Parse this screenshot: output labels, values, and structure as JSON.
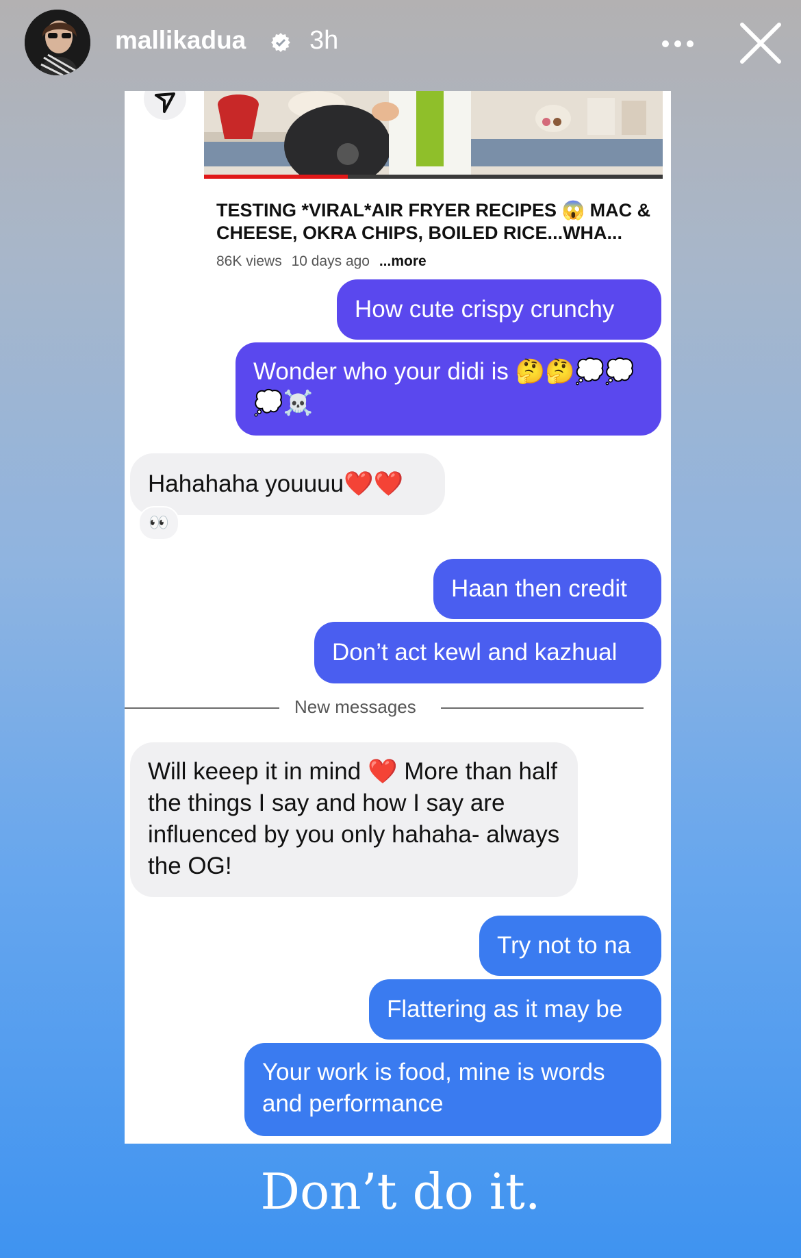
{
  "header": {
    "username": "mallikadua",
    "timestamp": "3h",
    "verified_icon": "verified-badge-icon",
    "more_icon": "more-horizontal-icon",
    "close_icon": "close-icon"
  },
  "video": {
    "title": "TESTING *VIRAL*AIR FRYER RECIPES 😱 MAC & CHEESE, OKRA CHIPS, BOILED RICE...WHA...",
    "views": "86K views",
    "age": "10 days ago",
    "more": "...more"
  },
  "messages": [
    {
      "from": "me",
      "text": "How cute crispy crunchy"
    },
    {
      "from": "me",
      "text": "Wonder who your didi is 🤔🤔💭💭💭☠️"
    },
    {
      "from": "them",
      "text": "Hahahaha youuuu❤️❤️",
      "reaction": "👀"
    },
    {
      "from": "me",
      "text": "Haan then credit"
    },
    {
      "from": "me",
      "text": "Don’t act kewl and kazhual"
    },
    {
      "from": "them",
      "text": "Will keeep it in mind ❤️ More than half the things I say and how I say are influenced by you only hahaha- always the OG!"
    },
    {
      "from": "me",
      "text": "Try not to na"
    },
    {
      "from": "me",
      "text": "Flattering as it may be"
    },
    {
      "from": "me",
      "text": "Your work is food, mine is words and performance"
    }
  ],
  "divider": {
    "label": "New messages"
  },
  "caption": "Don’t do it.",
  "colors": {
    "bubble_purple": "#5a48ee",
    "bubble_indigo": "#4a5ef0",
    "bubble_blue": "#3a7bf0",
    "incoming_bubble": "#f0f0f2"
  }
}
